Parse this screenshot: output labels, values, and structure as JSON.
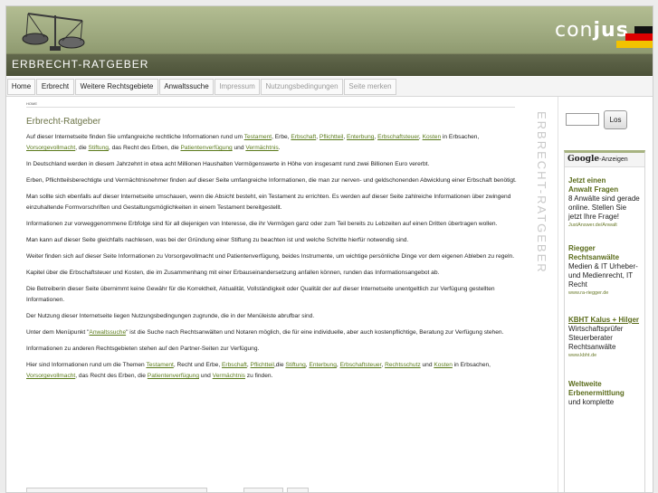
{
  "brand": {
    "logo_left": "con",
    "logo_right": "jus"
  },
  "site_title": "ERBRECHT-RATGEBER",
  "nav": [
    {
      "label": "Home",
      "dim": false
    },
    {
      "label": "Erbrecht",
      "dim": false
    },
    {
      "label": "Weitere Rechtsgebiete",
      "dim": false
    },
    {
      "label": "Anwaltssuche",
      "dim": false
    },
    {
      "label": "Impressum",
      "dim": true
    },
    {
      "label": "Nutzungsbedingungen",
      "dim": true
    },
    {
      "label": "Seite merken",
      "dim": true
    }
  ],
  "breadcrumb": "HOME",
  "page_heading": "Erbrecht-Ratgeber",
  "vertical_title": "ERBRECHT-RATGEBER",
  "paragraphs": [
    [
      [
        "Auf dieser Internetseite finden Sie umfangreiche rechtliche Informationen rund um ",
        false
      ],
      [
        "Testament",
        true
      ],
      [
        ", Erbe, ",
        false
      ],
      [
        "Erbschaft",
        true
      ],
      [
        ", ",
        false
      ],
      [
        "Pflichtteil",
        true
      ],
      [
        ", ",
        false
      ],
      [
        "Enterbung",
        true
      ],
      [
        ", ",
        false
      ],
      [
        "Erbschaftsteuer",
        true
      ],
      [
        ", ",
        false
      ],
      [
        "Kosten",
        true
      ],
      [
        " in Erbsachen, ",
        false
      ],
      [
        "Vorsorgevollmacht",
        true
      ],
      [
        ", die ",
        false
      ],
      [
        "Stiftung",
        true
      ],
      [
        ", das Recht des Erben, die ",
        false
      ],
      [
        "Patientenverfügung",
        true
      ],
      [
        " und ",
        false
      ],
      [
        "Vermächtnis",
        true
      ],
      [
        ".",
        false
      ]
    ],
    [
      [
        "In Deutschland werden in diesem Jahrzehnt in etwa acht Millionen Haushalten Vermögenswerte in Höhe von insgesamt rund zwei Billionen Euro vererbt.",
        false
      ]
    ],
    [
      [
        "Erben, Pflichtteilsberechtigte und Vermächtnisnehmer finden auf dieser Seite umfangreiche Informationen, die man zur nerven- und geldschonenden Abwicklung einer Erbschaft benötigt.",
        false
      ]
    ],
    [
      [
        "Man sollte sich ebenfalls auf dieser Internetseite umschauen, wenn die Absicht besteht, ein Testament zu errichten. Es werden auf dieser Seite zahlreiche Informationen über zwingend einzuhaltende Formvorschriften und Gestaltungsmöglichkeiten in einem Testament bereitgestellt.",
        false
      ]
    ],
    [
      [
        "Informationen zur vorweggenommene Erbfolge sind für all diejenigen von Interesse, die ihr Vermögen ganz oder zum Teil bereits zu Lebzeiten auf einen Dritten übertragen wollen.",
        false
      ]
    ],
    [
      [
        "Man kann auf dieser Seite gleichfalls nachlesen, was bei der Gründung einer Stiftung zu beachten ist und welche Schritte hierfür notwendig sind.",
        false
      ]
    ],
    [
      [
        "Weiter finden sich auf dieser Seite Informationen zu Vorsorgevollmacht und Patientenverfügung, beides Instrumente, um wichtige persönliche Dinge vor dem eigenen Ableben zu regeln.",
        false
      ]
    ],
    [
      [
        "Kapitel über die Erbschaftsteuer und Kosten, die im Zusammenhang mit einer Erbauseinandersetzung anfallen können, runden das Informationsangebot ab.",
        false
      ]
    ],
    [
      [
        "Die Betreiberin dieser Seite übernimmt keine Gewähr für die Korrektheit, Aktualität, Vollständigkeit oder Qualität der auf dieser Internetseite unentgeltlich zur Verfügung gestellten Informationen.",
        false
      ]
    ],
    [
      [
        "Der Nutzung dieser Internetseite liegen Nutzungsbedingungen zugrunde, die in der Menüleiste abrufbar sind.",
        false
      ]
    ],
    [
      [
        "Unter dem Menüpunkt \"",
        false
      ],
      [
        "Anwaltssuche",
        true
      ],
      [
        "\" ist die Suche nach Rechtsanwälten und Notaren möglich, die für eine individuelle, aber auch kostenpflichtige, Beratung zur Verfügung stehen.",
        false
      ]
    ],
    [
      [
        "Informationen zu anderen Rechtsgebieten stehen auf den Partner-Seiten zur Verfügung.",
        false
      ]
    ],
    [
      [
        "Hier sind Informationen rund um die Themen ",
        false
      ],
      [
        "Testament",
        true
      ],
      [
        ", Recht und Erbe, ",
        false
      ],
      [
        "Erbschaft",
        true
      ],
      [
        ", ",
        false
      ],
      [
        "Pflichtteil",
        true
      ],
      [
        ",die ",
        false
      ],
      [
        "Stiftung",
        true
      ],
      [
        ", ",
        false
      ],
      [
        "Enterbung",
        true
      ],
      [
        ", ",
        false
      ],
      [
        "Erbschaftsteuer",
        true
      ],
      [
        ", ",
        false
      ],
      [
        "Rechtsschutz",
        true
      ],
      [
        " und ",
        false
      ],
      [
        "Kosten",
        true
      ],
      [
        " in Erbsachen, ",
        false
      ],
      [
        "Vorsorgevollmacht",
        true
      ],
      [
        ", das Recht des Erben, die ",
        false
      ],
      [
        "Patientenverfügung",
        true
      ],
      [
        " und ",
        false
      ],
      [
        "Vermächtnis",
        true
      ],
      [
        " zu finden.",
        false
      ]
    ]
  ],
  "search": {
    "button": "Los",
    "value": ""
  },
  "ads": {
    "header_brand": "Google",
    "header_suffix": "-Anzeigen",
    "items": [
      {
        "title": "Jetzt einen ",
        "title_link": "Anwalt Fragen",
        "body": "8 Anwälte sind gerade online. Stellen Sie jetzt Ihre Frage!",
        "url": "JustAnswer.de/Anwalt"
      },
      {
        "title": "Riegger ",
        "title_link": "Rechtsanwälte",
        "body": "Medien & IT Urheber- und Medienrecht, IT Recht",
        "url": "www.ra-riegger.de"
      },
      {
        "title": "KBHT Kalus + Hilger",
        "title_link": "",
        "body": "Wirtschaftsprüfer Steuerberater Rechtsanwälte",
        "url": "www.kbht.de"
      },
      {
        "title": "Weltweite ",
        "title_link": "Erbenermittlung",
        "body": "und komplette",
        "url": ""
      }
    ]
  },
  "colors": {
    "banner": "#9ea97f",
    "titlebar": "#555b40",
    "link": "#5a7a1a",
    "heading": "#6b7346"
  }
}
